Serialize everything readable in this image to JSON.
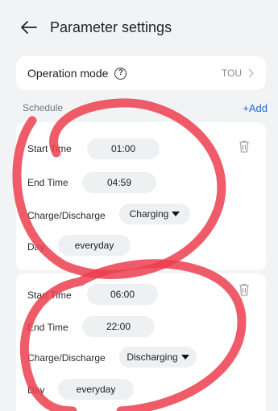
{
  "header": {
    "title": "Parameter settings"
  },
  "operation_mode": {
    "label": "Operation mode",
    "help_glyph": "?",
    "value": "TOU"
  },
  "schedule": {
    "label": "Schedule",
    "add_label": "+Add"
  },
  "labels": {
    "start": "Start Time",
    "end": "End Time",
    "charge": "Charge/Discharge",
    "day": "Day"
  },
  "entries": [
    {
      "start": "01:00",
      "end": "04:59",
      "mode": "Charging",
      "day": "everyday"
    },
    {
      "start": "06:00",
      "end": "22:00",
      "mode": "Discharging",
      "day": "everyday"
    }
  ],
  "colors": {
    "accent": "#1f67d8",
    "annotation": "#ec3e4f"
  }
}
